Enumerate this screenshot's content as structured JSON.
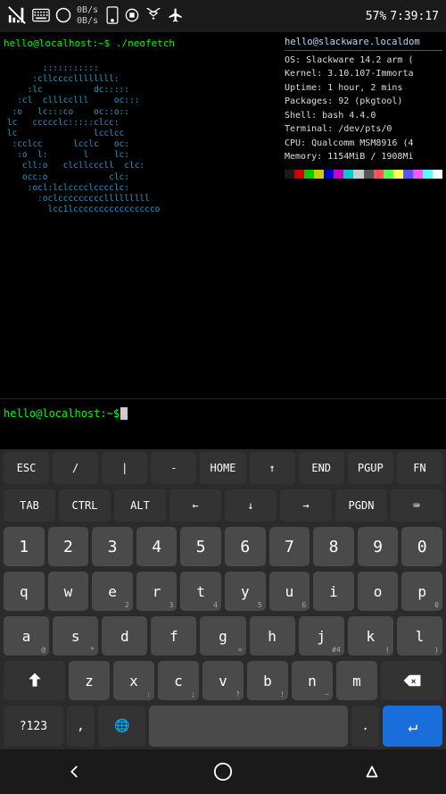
{
  "statusBar": {
    "dataRates": [
      "0B/s",
      "0B/s"
    ],
    "battery": "57%",
    "time": "7:39:17"
  },
  "terminal": {
    "cmdLine1": "hello@localhost:~$ ./neofetch",
    "hostname": "hello@slackware.localdom",
    "os": "OS:       Slackware 14.2 arm (",
    "kernel": "Kernel:   3.10.107-Immorta",
    "uptime": "Uptime:   1 hour, 2 mins",
    "packages": "Packages: 92 (pkgtool)",
    "shell": "Shell:    bash 4.4.0",
    "terminal": "Terminal: /dev/pts/0",
    "cpu": "CPU:      Qualcomm MSM8916 (4",
    "memory": "Memory:   1154MiB / 1908Mi",
    "prompt": "hello@localhost:~$"
  },
  "keyboard": {
    "row1": [
      "ESC",
      "/",
      "|",
      "-",
      "HOME",
      "↑",
      "END",
      "PGUP",
      "FN"
    ],
    "row2": [
      "TAB",
      "CTRL",
      "ALT",
      "←",
      "↓",
      "→",
      "PGDN",
      "⌨"
    ],
    "nums": [
      "1",
      "2",
      "3",
      "4",
      "5",
      "6",
      "7",
      "8",
      "9",
      "0"
    ],
    "numsub": [
      "",
      "",
      "",
      "",
      "",
      "",
      "",
      "",
      "",
      ""
    ],
    "qrow": [
      "q",
      "w",
      "e",
      "r",
      "t",
      "y",
      "u",
      "i",
      "o",
      "p"
    ],
    "qsub": [
      "",
      "",
      "2",
      "3",
      "4",
      "5",
      "6",
      "",
      "",
      "0"
    ],
    "arow": [
      "a",
      "s",
      "d",
      "f",
      "g",
      "h",
      "j",
      "k",
      "l"
    ],
    "asub": [
      "@",
      "*",
      "",
      "",
      "=",
      "",
      "#4",
      "(",
      ")"
    ],
    "zrow": [
      "z",
      "x",
      "c",
      "v",
      "b",
      "n",
      "m"
    ],
    "zsub": [
      "",
      ":",
      ";",
      "?",
      "!",
      "~",
      ""
    ],
    "bottomRow": {
      "numSwitch": "?123",
      "comma": ",",
      "globe": "🌐",
      "space": "",
      "period": ".",
      "enter": "↵"
    }
  },
  "navBar": {
    "back": "◁",
    "home": "○",
    "recents": "▽"
  }
}
